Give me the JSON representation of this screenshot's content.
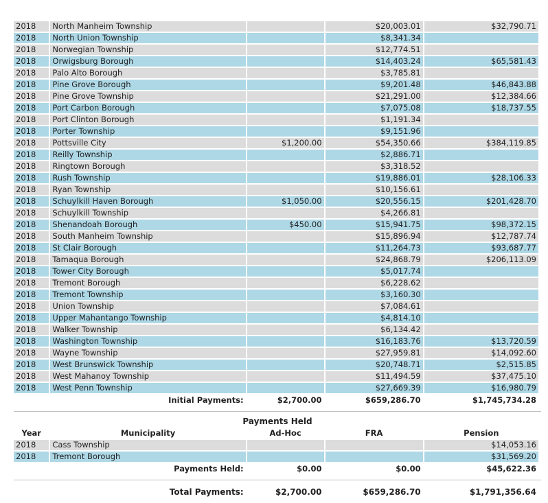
{
  "initial_rows": [
    {
      "year": "2018",
      "municipality": "North Manheim Township",
      "adhoc": "",
      "fra": "$20,003.01",
      "pension": "$32,790.71"
    },
    {
      "year": "2018",
      "municipality": "North Union Township",
      "adhoc": "",
      "fra": "$8,341.34",
      "pension": ""
    },
    {
      "year": "2018",
      "municipality": "Norwegian Township",
      "adhoc": "",
      "fra": "$12,774.51",
      "pension": ""
    },
    {
      "year": "2018",
      "municipality": "Orwigsburg Borough",
      "adhoc": "",
      "fra": "$14,403.24",
      "pension": "$65,581.43"
    },
    {
      "year": "2018",
      "municipality": "Palo Alto Borough",
      "adhoc": "",
      "fra": "$3,785.81",
      "pension": ""
    },
    {
      "year": "2018",
      "municipality": "Pine Grove Borough",
      "adhoc": "",
      "fra": "$9,201.48",
      "pension": "$46,843.88"
    },
    {
      "year": "2018",
      "municipality": "Pine Grove Township",
      "adhoc": "",
      "fra": "$21,291.00",
      "pension": "$12,384.66"
    },
    {
      "year": "2018",
      "municipality": "Port Carbon Borough",
      "adhoc": "",
      "fra": "$7,075.08",
      "pension": "$18,737.55"
    },
    {
      "year": "2018",
      "municipality": "Port Clinton Borough",
      "adhoc": "",
      "fra": "$1,191.34",
      "pension": ""
    },
    {
      "year": "2018",
      "municipality": "Porter Township",
      "adhoc": "",
      "fra": "$9,151.96",
      "pension": ""
    },
    {
      "year": "2018",
      "municipality": "Pottsville City",
      "adhoc": "$1,200.00",
      "fra": "$54,350.66",
      "pension": "$384,119.85"
    },
    {
      "year": "2018",
      "municipality": "Reilly Township",
      "adhoc": "",
      "fra": "$2,886.71",
      "pension": ""
    },
    {
      "year": "2018",
      "municipality": "Ringtown Borough",
      "adhoc": "",
      "fra": "$3,318.52",
      "pension": ""
    },
    {
      "year": "2018",
      "municipality": "Rush Township",
      "adhoc": "",
      "fra": "$19,886.01",
      "pension": "$28,106.33"
    },
    {
      "year": "2018",
      "municipality": "Ryan Township",
      "adhoc": "",
      "fra": "$10,156.61",
      "pension": ""
    },
    {
      "year": "2018",
      "municipality": "Schuylkill Haven Borough",
      "adhoc": "$1,050.00",
      "fra": "$20,556.15",
      "pension": "$201,428.70"
    },
    {
      "year": "2018",
      "municipality": "Schuylkill Township",
      "adhoc": "",
      "fra": "$4,266.81",
      "pension": ""
    },
    {
      "year": "2018",
      "municipality": "Shenandoah Borough",
      "adhoc": "$450.00",
      "fra": "$15,941.75",
      "pension": "$98,372.15"
    },
    {
      "year": "2018",
      "municipality": "South Manheim Township",
      "adhoc": "",
      "fra": "$15,896.94",
      "pension": "$12,787.74"
    },
    {
      "year": "2018",
      "municipality": "St Clair Borough",
      "adhoc": "",
      "fra": "$11,264.73",
      "pension": "$93,687.77"
    },
    {
      "year": "2018",
      "municipality": "Tamaqua Borough",
      "adhoc": "",
      "fra": "$24,868.79",
      "pension": "$206,113.09"
    },
    {
      "year": "2018",
      "municipality": "Tower City Borough",
      "adhoc": "",
      "fra": "$5,017.74",
      "pension": ""
    },
    {
      "year": "2018",
      "municipality": "Tremont Borough",
      "adhoc": "",
      "fra": "$6,228.62",
      "pension": ""
    },
    {
      "year": "2018",
      "municipality": "Tremont Township",
      "adhoc": "",
      "fra": "$3,160.30",
      "pension": ""
    },
    {
      "year": "2018",
      "municipality": "Union Township",
      "adhoc": "",
      "fra": "$7,084.61",
      "pension": ""
    },
    {
      "year": "2018",
      "municipality": "Upper Mahantango Township",
      "adhoc": "",
      "fra": "$4,814.10",
      "pension": ""
    },
    {
      "year": "2018",
      "municipality": "Walker Township",
      "adhoc": "",
      "fra": "$6,134.42",
      "pension": ""
    },
    {
      "year": "2018",
      "municipality": "Washington Township",
      "adhoc": "",
      "fra": "$16,183.76",
      "pension": "$13,720.59"
    },
    {
      "year": "2018",
      "municipality": "Wayne Township",
      "adhoc": "",
      "fra": "$27,959.81",
      "pension": "$14,092.60"
    },
    {
      "year": "2018",
      "municipality": "West Brunswick Township",
      "adhoc": "",
      "fra": "$20,748.71",
      "pension": "$2,515.85"
    },
    {
      "year": "2018",
      "municipality": "West Mahanoy Township",
      "adhoc": "",
      "fra": "$11,494.59",
      "pension": "$37,475.10"
    },
    {
      "year": "2018",
      "municipality": "West Penn Township",
      "adhoc": "",
      "fra": "$27,669.39",
      "pension": "$16,980.79"
    }
  ],
  "initial_totals": {
    "label": "Initial Payments:",
    "adhoc": "$2,700.00",
    "fra": "$659,286.70",
    "pension": "$1,745,734.28"
  },
  "held": {
    "title": "Payments Held",
    "headers": {
      "year": "Year",
      "municipality": "Municipality",
      "adhoc": "Ad-Hoc",
      "fra": "FRA",
      "pension": "Pension"
    },
    "rows": [
      {
        "year": "2018",
        "municipality": "Cass Township",
        "adhoc": "",
        "fra": "",
        "pension": "$14,053.16"
      },
      {
        "year": "2018",
        "municipality": "Tremont Borough",
        "adhoc": "",
        "fra": "",
        "pension": "$31,569.20"
      }
    ],
    "totals": {
      "label": "Payments Held:",
      "adhoc": "$0.00",
      "fra": "$0.00",
      "pension": "$45,622.36"
    }
  },
  "grand_totals": {
    "label": "Total Payments:",
    "adhoc": "$2,700.00",
    "fra": "$659,286.70",
    "pension": "$1,791,356.64"
  },
  "colors": {
    "row_gray": "#dcdcdc",
    "row_blue": "#aed8e6"
  }
}
